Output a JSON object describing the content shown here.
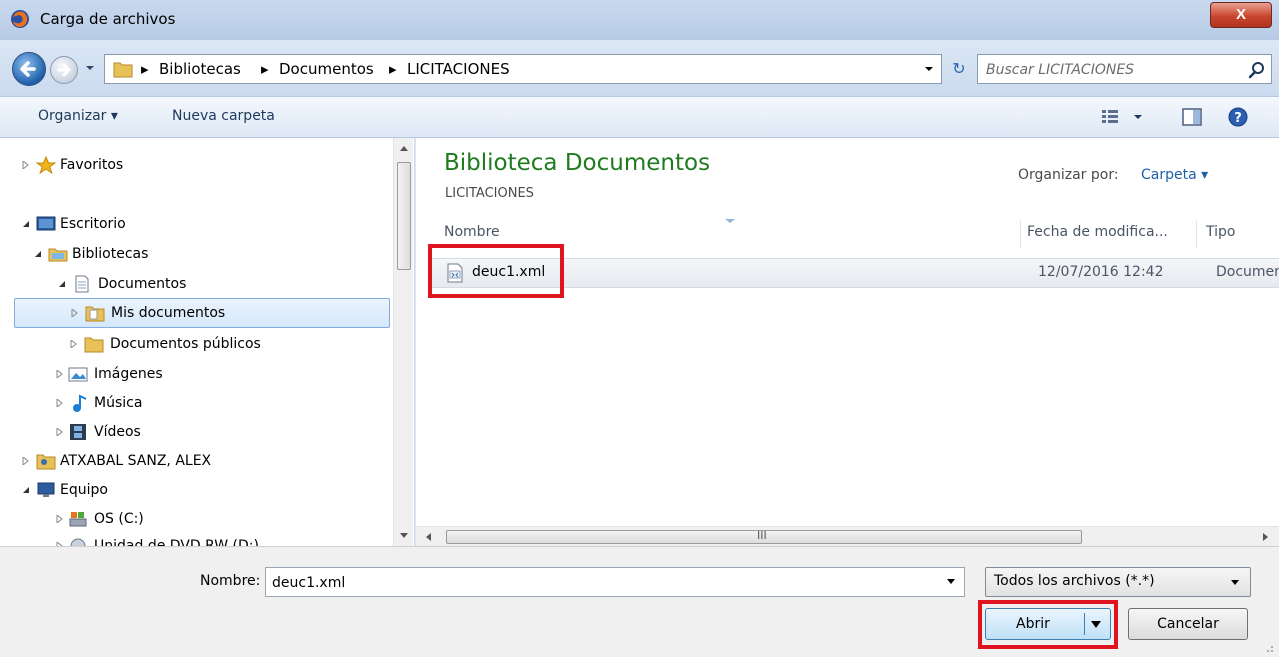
{
  "window": {
    "title": "Carga de archivos",
    "close_label": "X"
  },
  "address_bar": {
    "crumbs": [
      "Bibliotecas",
      "Documentos",
      "LICITACIONES"
    ],
    "search_placeholder": "Buscar LICITACIONES"
  },
  "toolbar": {
    "organize_label": "Organizar ▾",
    "new_folder_label": "Nueva carpeta"
  },
  "nav_tree": {
    "items": [
      {
        "label": "Favoritos"
      },
      {
        "label": "Escritorio"
      },
      {
        "label": "Bibliotecas"
      },
      {
        "label": "Documentos"
      },
      {
        "label": "Mis documentos"
      },
      {
        "label": "Documentos públicos"
      },
      {
        "label": "Imágenes"
      },
      {
        "label": "Música"
      },
      {
        "label": "Vídeos"
      },
      {
        "label": "ATXABAL SANZ, ALEX"
      },
      {
        "label": "Equipo"
      },
      {
        "label": "OS (C:)"
      },
      {
        "label": "Unidad de DVD RW (D:)"
      }
    ]
  },
  "main": {
    "library_title": "Biblioteca Documentos",
    "library_subtitle": "LICITACIONES",
    "arrange_label": "Organizar por:",
    "arrange_value": "Carpeta ▾",
    "columns": {
      "name": "Nombre",
      "modified": "Fecha de modifica...",
      "type": "Tipo"
    },
    "files": [
      {
        "name": "deuc1.xml",
        "modified": "12/07/2016 12:42",
        "type": "Documento XML"
      }
    ],
    "hscroll_grip": "III"
  },
  "bottom": {
    "name_label": "Nombre:",
    "name_value": "deuc1.xml",
    "filter_value": "Todos los archivos (*.*)",
    "open_label": "Abrir",
    "cancel_label": "Cancelar"
  },
  "colors": {
    "highlight": "#e0141e",
    "library_title": "#1e7b1e",
    "link": "#1f5fa8"
  }
}
